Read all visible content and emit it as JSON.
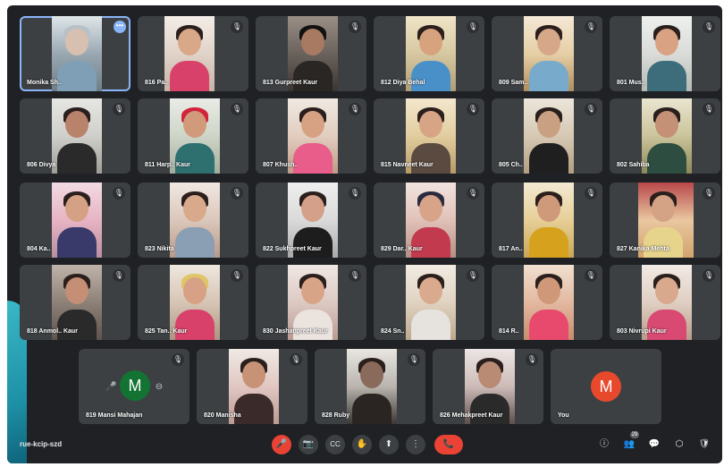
{
  "meeting": {
    "code": "rue-kcip-szd"
  },
  "participants": [
    {
      "name": "Monika Sh..",
      "muted": false,
      "active": true
    },
    {
      "name": "816 Pa..",
      "muted": true
    },
    {
      "name": "813 Gurpreet Kaur",
      "muted": true
    },
    {
      "name": "812 Diya Behal",
      "muted": true
    },
    {
      "name": "809 Sam..",
      "muted": true
    },
    {
      "name": "801 Mus..",
      "muted": true
    },
    {
      "name": "806 Divya",
      "muted": true
    },
    {
      "name": "811 Harp.. Kaur",
      "muted": true
    },
    {
      "name": "807 Khush..",
      "muted": true
    },
    {
      "name": "815 Navneet Kaur",
      "muted": true
    },
    {
      "name": "805 Ch..",
      "muted": true
    },
    {
      "name": "802 Sahiba",
      "muted": true
    },
    {
      "name": "804 Ka..",
      "muted": true
    },
    {
      "name": "823 Nikita",
      "muted": true
    },
    {
      "name": "822 Sukhpreet Kaur",
      "muted": true
    },
    {
      "name": "829 Dar.. Kaur",
      "muted": true
    },
    {
      "name": "817 An..",
      "muted": true
    },
    {
      "name": "827 Kanika Mehta",
      "muted": true
    },
    {
      "name": "818 Anmol.. Kaur",
      "muted": true
    },
    {
      "name": "825 Tan.. Kaur",
      "muted": true
    },
    {
      "name": "830 Jashanpreet Kaur",
      "muted": true
    },
    {
      "name": "824 Sn..",
      "muted": true
    },
    {
      "name": "814 R..",
      "muted": true
    },
    {
      "name": "803 Nivrupi Kaur",
      "muted": true
    },
    {
      "name": "819 Mansi Mahajan",
      "muted": true,
      "avatar_letter": "M"
    },
    {
      "name": "820 Manisha",
      "muted": true
    },
    {
      "name": "828 Ruby",
      "muted": true
    },
    {
      "name": "826 Mehakpreet Kaur",
      "muted": true
    },
    {
      "name": "You",
      "muted": false,
      "avatar_letter": "M"
    }
  ],
  "icons": {
    "mic_off": "🎙",
    "more": "•••",
    "mic": "🎤",
    "camera": "📷",
    "captions": "CC",
    "hand": "✋",
    "present": "⬆",
    "more_vert": "⋮",
    "leave": "📞",
    "info": "ⓘ",
    "people": "👥",
    "chat": "💬",
    "activities": "⬡",
    "host": "🛡"
  },
  "badges": {
    "people_count": "29"
  },
  "colors": {
    "background": "#1f2124",
    "tile": "#3c4043",
    "red": "#ea4335",
    "avatar_green": "#137333",
    "avatar_orange": "#e8492d",
    "accent": "#8ab4f8"
  }
}
